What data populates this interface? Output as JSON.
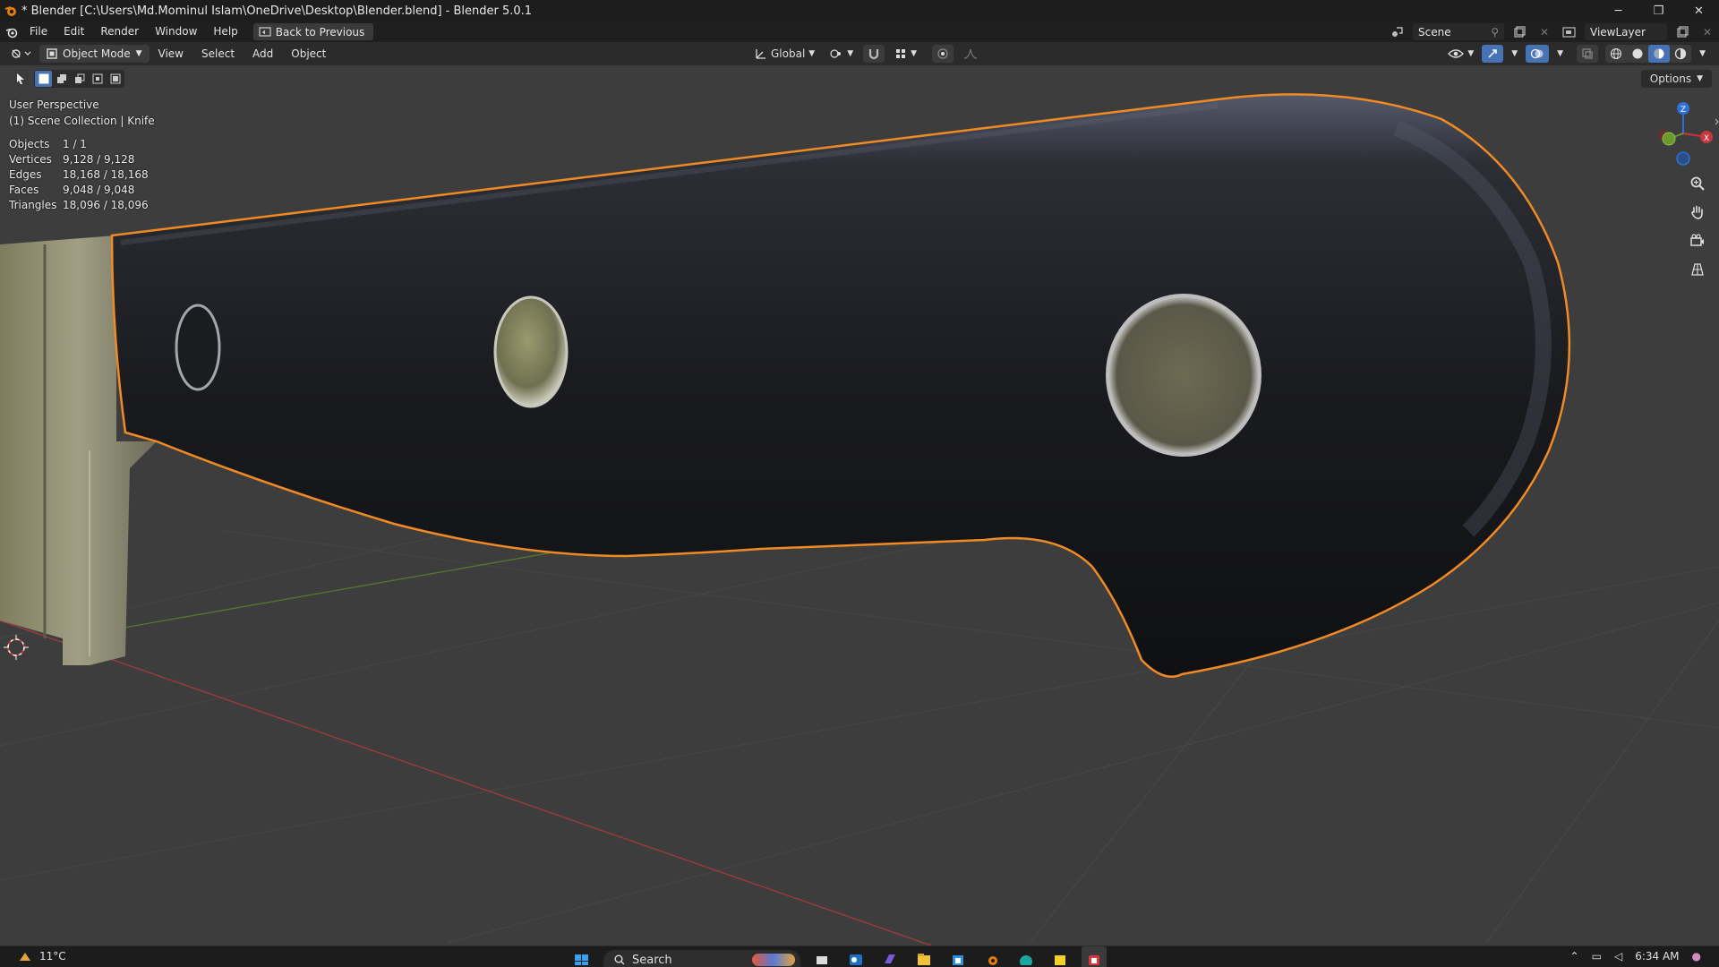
{
  "window": {
    "title": "* Blender [C:\\Users\\Md.Mominul Islam\\OneDrive\\Desktop\\Blender.blend] - Blender 5.0.1",
    "controls": {
      "minimize": "─",
      "maximize": "❐",
      "close": "✕"
    }
  },
  "menubar": {
    "items": [
      "File",
      "Edit",
      "Render",
      "Window",
      "Help"
    ],
    "back_button": "Back to Previous",
    "scene": "Scene",
    "view_layer": "ViewLayer"
  },
  "viewport_header": {
    "mode": "Object Mode",
    "menus": [
      "View",
      "Select",
      "Add",
      "Object"
    ],
    "orientation": "Global",
    "options": "Options"
  },
  "overlay": {
    "perspective": "User Perspective",
    "collection": "(1) Scene Collection | Knife"
  },
  "stats": [
    {
      "label": "Objects",
      "value": "1 / 1"
    },
    {
      "label": "Vertices",
      "value": "9,128 / 9,128"
    },
    {
      "label": "Edges",
      "value": "18,168 / 18,168"
    },
    {
      "label": "Faces",
      "value": "9,048 / 9,048"
    },
    {
      "label": "Triangles",
      "value": "18,096 / 18,096"
    }
  ],
  "gizmo": {
    "z": "Z",
    "x": "X"
  },
  "taskbar": {
    "weather": "11°C",
    "search_placeholder": "Search",
    "time": "6:34 AM"
  },
  "colors": {
    "selection_outline": "#f08a24",
    "accent": "#4772b3",
    "axis_x": "#c8363e",
    "axis_y": "#6a9a2c",
    "axis_z": "#2f6fd6"
  }
}
